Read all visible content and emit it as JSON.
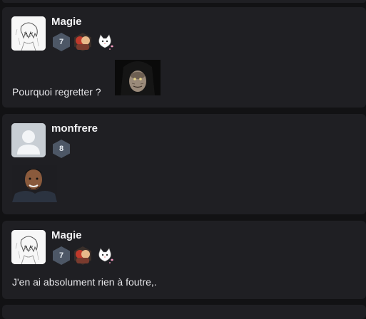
{
  "posts": [
    {
      "username": "Magie",
      "level": "7",
      "text": "Pourquoi regretter ?"
    },
    {
      "username": "monfrere",
      "level": "8",
      "text": ""
    },
    {
      "username": "Magie",
      "level": "7",
      "text": "J'en ai absolument rien à foutre,."
    }
  ],
  "colors": {
    "background": "#121214",
    "card": "#1f1f23",
    "level_badge": "#4d5766"
  }
}
